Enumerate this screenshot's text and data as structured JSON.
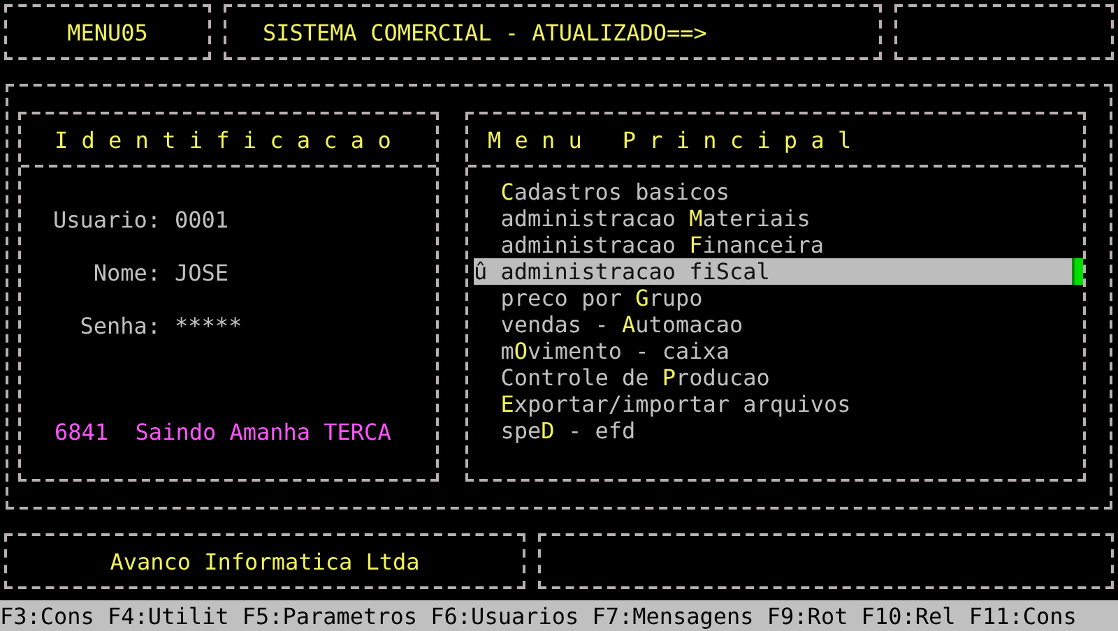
{
  "header": {
    "program": "MENU05",
    "title": "SISTEMA COMERCIAL - ATUALIZADO==>"
  },
  "identification": {
    "title": "I d e n t i f i c a c a o",
    "fields": [
      {
        "label": "Usuario:",
        "value": "0001"
      },
      {
        "label": "Nome:",
        "value": "JOSE"
      },
      {
        "label": "Senha:",
        "value": "*****"
      }
    ],
    "message": "6841  Saindo Amanha TERCA"
  },
  "menu": {
    "title": "M e n u   P r i n c i p a l",
    "cursor": "û",
    "items": [
      {
        "hotkey": "C",
        "after": "adastros basicos",
        "selected": false
      },
      {
        "before": "administracao ",
        "hotkey": "M",
        "after": "ateriais",
        "selected": false
      },
      {
        "before": "administracao ",
        "hotkey": "F",
        "after": "inanceira",
        "selected": false
      },
      {
        "before": "administracao fi",
        "hotkey": "S",
        "after": "cal",
        "selected": true
      },
      {
        "before": "preco por ",
        "hotkey": "G",
        "after": "rupo",
        "selected": false
      },
      {
        "before": "vendas - ",
        "hotkey": "A",
        "after": "utomacao",
        "selected": false
      },
      {
        "before": "m",
        "hotkey": "O",
        "after": "vimento - caixa",
        "selected": false
      },
      {
        "before": "Controle de ",
        "hotkey": "P",
        "after": "roducao",
        "selected": false
      },
      {
        "hotkey": "E",
        "after": "xportar/importar arquivos",
        "selected": false
      },
      {
        "before": "spe",
        "hotkey": "D",
        "after": " - efd",
        "selected": false
      }
    ]
  },
  "footer": {
    "company": "Avanco Informatica Ltda"
  },
  "status_bar": [
    "F3:Cons",
    "F4:Utilit",
    "F5:Parametros",
    "F6:Usuarios",
    "F7:Mensagens",
    "F9:Rot",
    "F10:Rel",
    "F11:Cons"
  ]
}
